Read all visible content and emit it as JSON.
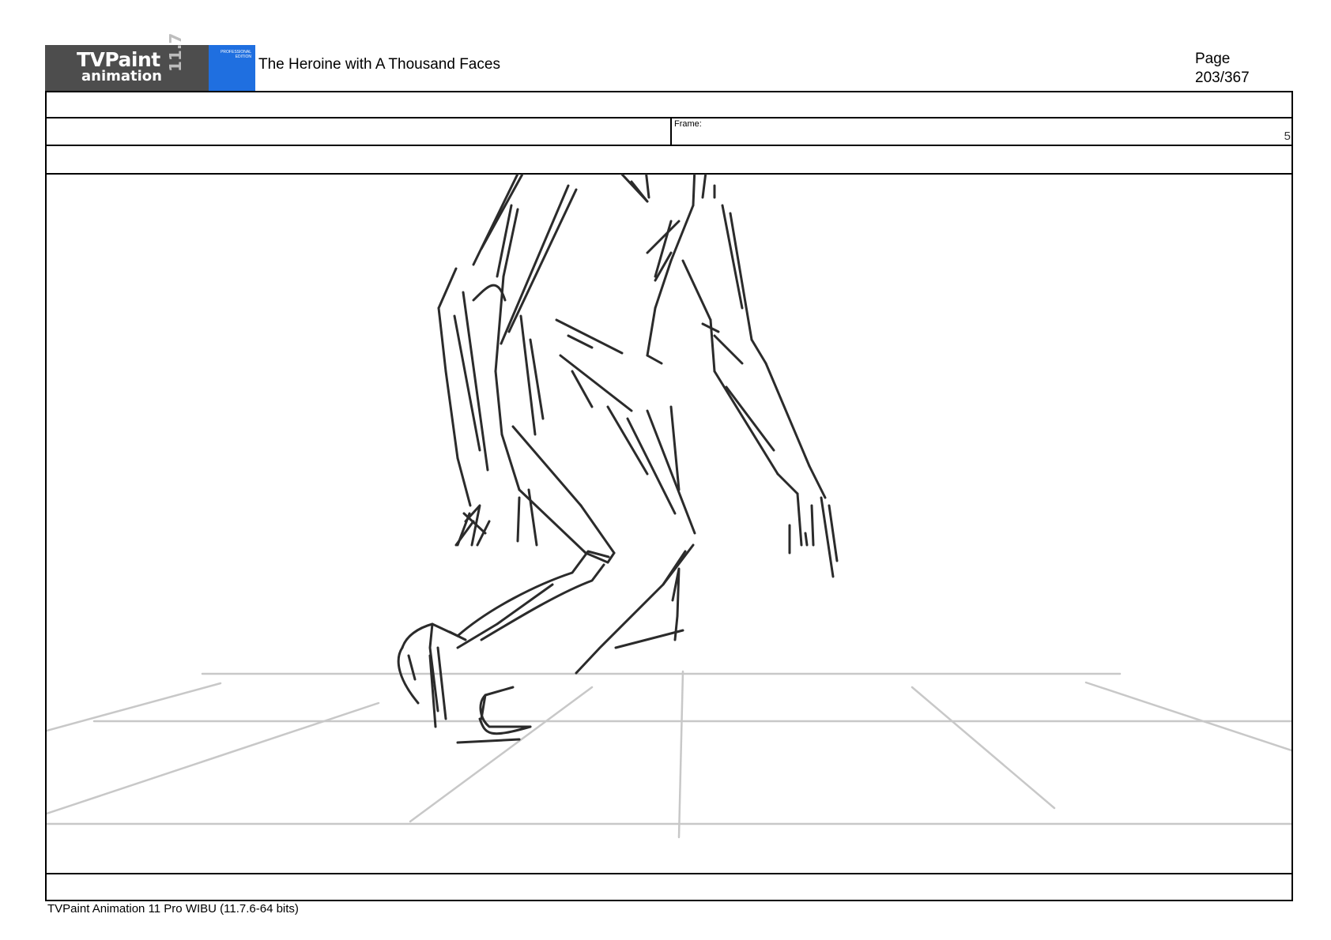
{
  "header": {
    "logo": {
      "brand": "TVPaint",
      "product": "animation",
      "version": "11.7",
      "edition": "PROFESSIONAL EDITION"
    },
    "title": "The Heroine with A Thousand Faces",
    "page_label": "Page",
    "page_number": "203/367"
  },
  "sheet": {
    "frame_label": "Frame:",
    "frame_number": "5"
  },
  "drawing": {
    "stroke_color": "#2b2b2b",
    "guide_color": "#c8c8c8"
  },
  "footer": {
    "text": "TVPaint Animation 11 Pro WIBU (11.7.6-64 bits)"
  }
}
